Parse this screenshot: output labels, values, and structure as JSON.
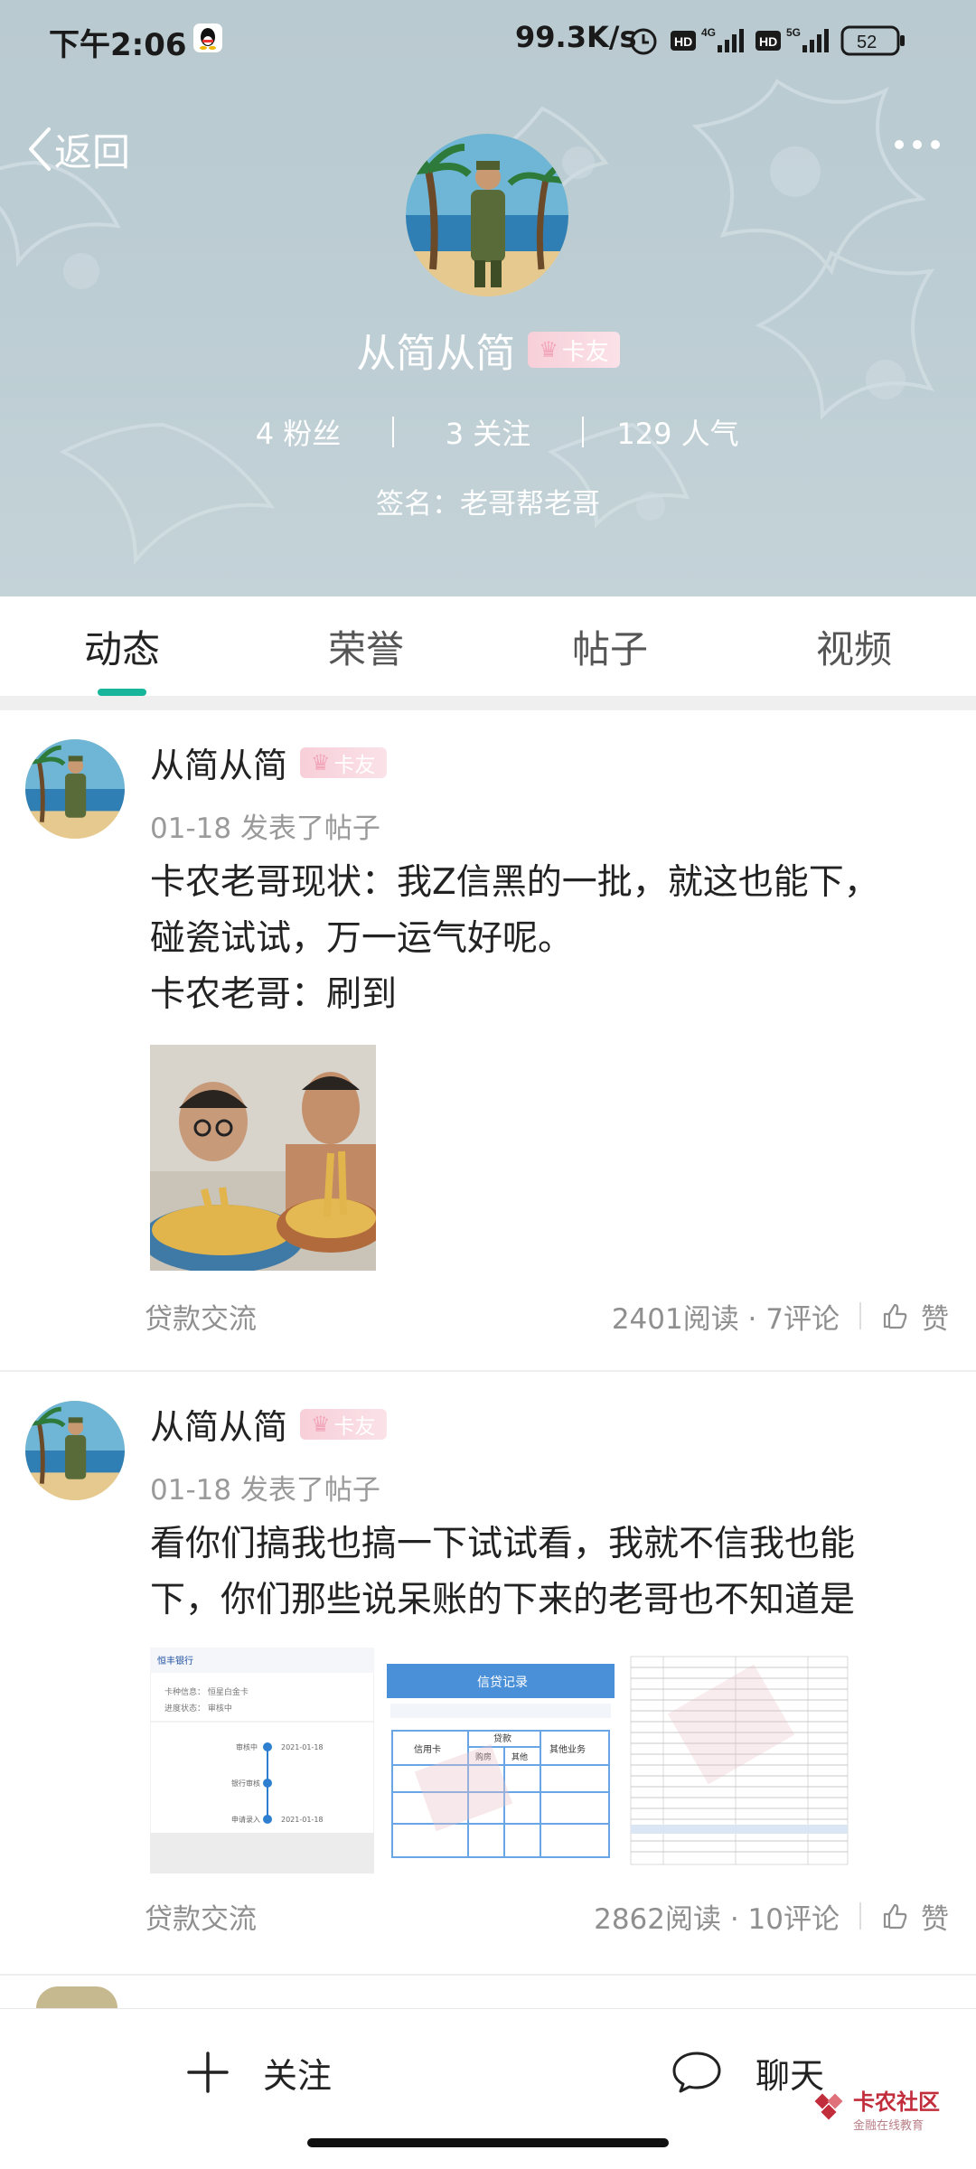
{
  "status_bar": {
    "time": "下午2:06",
    "network_speed": "99.3K/s",
    "battery": "52",
    "signal_labels": [
      "4G",
      "5G"
    ],
    "hd_label": "HD"
  },
  "header": {
    "back_label": "返回",
    "username": "从简从简",
    "badge": "卡友",
    "stats": {
      "fans": "4 粉丝",
      "following": "3 关注",
      "popularity": "129 人气"
    },
    "signature": "签名：老哥帮老哥"
  },
  "tabs": [
    {
      "label": "动态",
      "active": true
    },
    {
      "label": "荣誉",
      "active": false
    },
    {
      "label": "帖子",
      "active": false
    },
    {
      "label": "视频",
      "active": false
    }
  ],
  "posts": [
    {
      "author": "从简从简",
      "badge": "卡友",
      "meta": "01-18  发表了帖子",
      "text_lines": [
        "卡农老哥现状：我Z信黑的一批，就这也能下，",
        "碰瓷试试，万一运气好呢。",
        "卡农老哥：刷到"
      ],
      "category": "贷款交流",
      "stats": "2401阅读 · 7评论",
      "like_label": "赞"
    },
    {
      "author": "从简从简",
      "badge": "卡友",
      "meta": "01-18  发表了帖子",
      "text_lines": [
        "看你们搞我也搞一下试试看，我就不信我也能",
        "下，你们那些说呆账的下来的老哥也不知道是"
      ],
      "thumb1": {
        "bank": "恒丰银行",
        "row1": "卡种信息：  恒星白金卡",
        "row2": "进度状态：  审核中",
        "steps": [
          "审核中",
          "银行审核",
          "申请录入"
        ],
        "dates": [
          "2021-01-18",
          "2021-01-18"
        ]
      },
      "thumb2": {
        "title": "信贷记录",
        "head": [
          "信用卡",
          "贷款",
          "其他业务"
        ],
        "sub": [
          "购房",
          "其他"
        ]
      },
      "category": "贷款交流",
      "stats": "2862阅读 · 10评论",
      "like_label": "赞"
    }
  ],
  "bottom_bar": {
    "follow_label": "关注",
    "chat_label": "聊天"
  },
  "watermark": {
    "name": "卡农社区",
    "sub": "金融在线教育"
  },
  "colors": {
    "accent": "#17b59a",
    "header_bg": "#bccdd3",
    "watermark": "#c22d3c"
  }
}
